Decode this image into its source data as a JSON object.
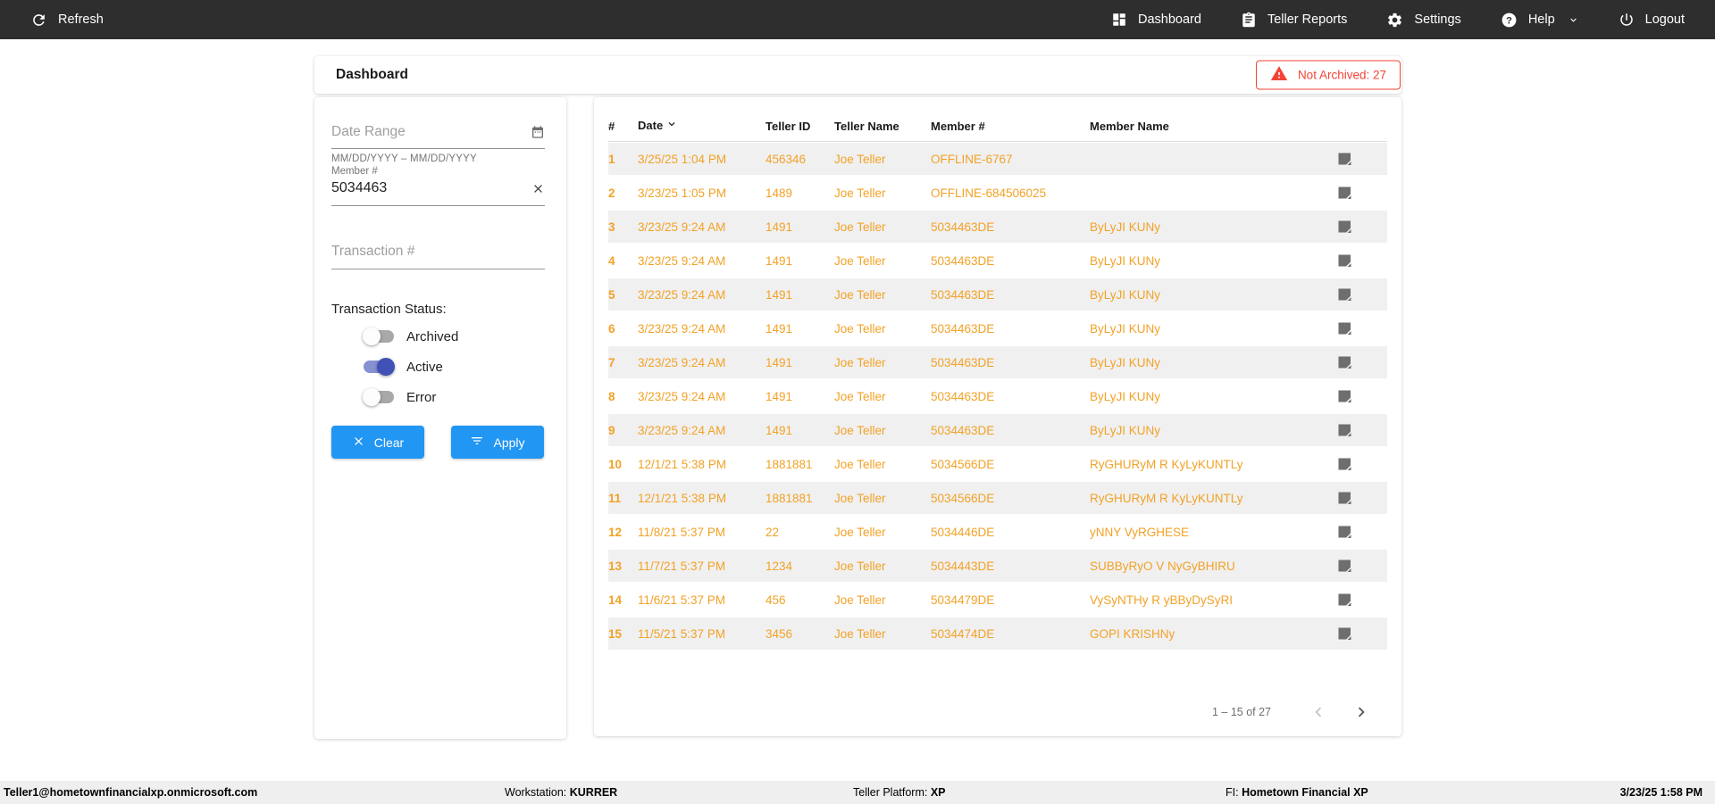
{
  "nav": {
    "refresh_label": "Refresh",
    "items": [
      {
        "label": "Dashboard"
      },
      {
        "label": "Teller Reports"
      },
      {
        "label": "Settings"
      },
      {
        "label": "Help"
      },
      {
        "label": "Logout"
      }
    ]
  },
  "header": {
    "title": "Dashboard",
    "alert_label": "Not Archived: 27"
  },
  "filters": {
    "date_range": {
      "placeholder": "Date Range",
      "hint": "MM/DD/YYYY – MM/DD/YYYY"
    },
    "member": {
      "label": "Member #",
      "value": "5034463"
    },
    "transaction": {
      "placeholder": "Transaction #"
    },
    "status": {
      "label": "Transaction Status:",
      "toggles": [
        {
          "label": "Archived",
          "on": false
        },
        {
          "label": "Active",
          "on": true
        },
        {
          "label": "Error",
          "on": false
        }
      ]
    },
    "clear_label": "Clear",
    "apply_label": "Apply"
  },
  "table": {
    "columns": [
      "#",
      "Date",
      "Teller ID",
      "Teller Name",
      "Member #",
      "Member Name"
    ],
    "sorted_by": "Date",
    "rows": [
      [
        "1",
        "3/25/25 1:04 PM",
        "456346",
        "Joe Teller",
        "OFFLINE-6767",
        ""
      ],
      [
        "2",
        "3/23/25 1:05 PM",
        "1489",
        "Joe Teller",
        "OFFLINE-684506025",
        ""
      ],
      [
        "3",
        "3/23/25 9:24 AM",
        "1491",
        "Joe Teller",
        "5034463DE",
        "ByLyJI KUNy"
      ],
      [
        "4",
        "3/23/25 9:24 AM",
        "1491",
        "Joe Teller",
        "5034463DE",
        "ByLyJI KUNy"
      ],
      [
        "5",
        "3/23/25 9:24 AM",
        "1491",
        "Joe Teller",
        "5034463DE",
        "ByLyJI KUNy"
      ],
      [
        "6",
        "3/23/25 9:24 AM",
        "1491",
        "Joe Teller",
        "5034463DE",
        "ByLyJI KUNy"
      ],
      [
        "7",
        "3/23/25 9:24 AM",
        "1491",
        "Joe Teller",
        "5034463DE",
        "ByLyJI KUNy"
      ],
      [
        "8",
        "3/23/25 9:24 AM",
        "1491",
        "Joe Teller",
        "5034463DE",
        "ByLyJI KUNy"
      ],
      [
        "9",
        "3/23/25 9:24 AM",
        "1491",
        "Joe Teller",
        "5034463DE",
        "ByLyJI KUNy"
      ],
      [
        "10",
        "12/1/21 5:38 PM",
        "1881881",
        "Joe Teller",
        "5034566DE",
        "RyGHURyM R KyLyKUNTLy"
      ],
      [
        "11",
        "12/1/21 5:38 PM",
        "1881881",
        "Joe Teller",
        "5034566DE",
        "RyGHURyM R KyLyKUNTLy"
      ],
      [
        "12",
        "11/8/21 5:37 PM",
        "22",
        "Joe Teller",
        "5034446DE",
        "yNNY VyRGHESE"
      ],
      [
        "13",
        "11/7/21 5:37 PM",
        "1234",
        "Joe Teller",
        "5034443DE",
        "SUBByRyO V NyGyBHIRU"
      ],
      [
        "14",
        "11/6/21 5:37 PM",
        "456",
        "Joe Teller",
        "5034479DE",
        "VySyNTHy R yBByDySyRI"
      ],
      [
        "15",
        "11/5/21 5:37 PM",
        "3456",
        "Joe Teller",
        "5034474DE",
        "GOPI KRISHNy"
      ]
    ],
    "pagination": {
      "label": "1 – 15 of 27",
      "prev_enabled": false,
      "next_enabled": true
    }
  },
  "footer": {
    "user": "Teller1@hometownfinancialxp.onmicrosoft.com",
    "workstation_label": "Workstation:",
    "workstation_value": "KURRER",
    "platform_label": "Teller Platform:",
    "platform_value": "XP",
    "fi_label": "FI:",
    "fi_value": "Hometown Financial XP",
    "timestamp": "3/23/25 1:58 PM"
  },
  "colors": {
    "navbar_bg": "#2e2e2e",
    "accent_blue": "#2196f3",
    "row_orange": "#f2a227",
    "alert_red": "#f44336",
    "toggle_indigo": "#3f51b5",
    "stripe_gray": "#f0f0f0"
  }
}
